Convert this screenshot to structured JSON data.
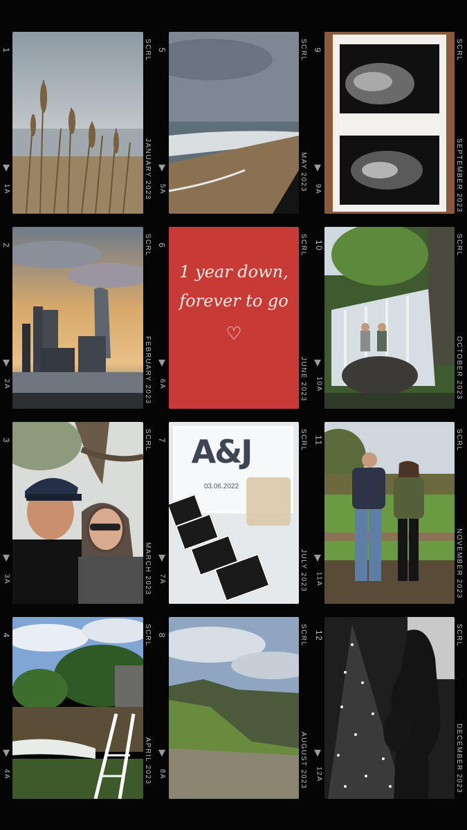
{
  "frames": [
    {
      "number": "1",
      "sub": "1A",
      "month": "JANUARY 2023",
      "brand": "SCRL"
    },
    {
      "number": "5",
      "sub": "5A",
      "month": "MAY 2023",
      "brand": "SCRL"
    },
    {
      "number": "9",
      "sub": "9A",
      "month": "SEPTEMBER 2023",
      "brand": "SCRL"
    },
    {
      "number": "2",
      "sub": "2A",
      "month": "FEBRUARY 2023",
      "brand": "SCRL"
    },
    {
      "number": "6",
      "sub": "6A",
      "month": "JUNE 2023",
      "brand": "SCRL"
    },
    {
      "number": "10",
      "sub": "10A",
      "month": "OCTOBER 2023",
      "brand": "SCRL"
    },
    {
      "number": "3",
      "sub": "3A",
      "month": "MARCH 2023",
      "brand": "SCRL"
    },
    {
      "number": "7",
      "sub": "7A",
      "month": "JULY 2023",
      "brand": "SCRL"
    },
    {
      "number": "11",
      "sub": "11A",
      "month": "NOVEMBER 2023",
      "brand": "SCRL"
    },
    {
      "number": "4",
      "sub": "4A",
      "month": "APRIL 2023",
      "brand": "SCRL"
    },
    {
      "number": "8",
      "sub": "8A",
      "month": "AUGUST 2023",
      "brand": "SCRL"
    },
    {
      "number": "12",
      "sub": "12A",
      "month": "DECEMBER 2023",
      "brand": "SCRL"
    }
  ],
  "card": {
    "line1": "1 year down,",
    "line2": "forever to go",
    "heart": "♡",
    "bg": "#c73a35"
  },
  "keepsake": {
    "initials": "A&J",
    "date": "03.06.2022"
  }
}
